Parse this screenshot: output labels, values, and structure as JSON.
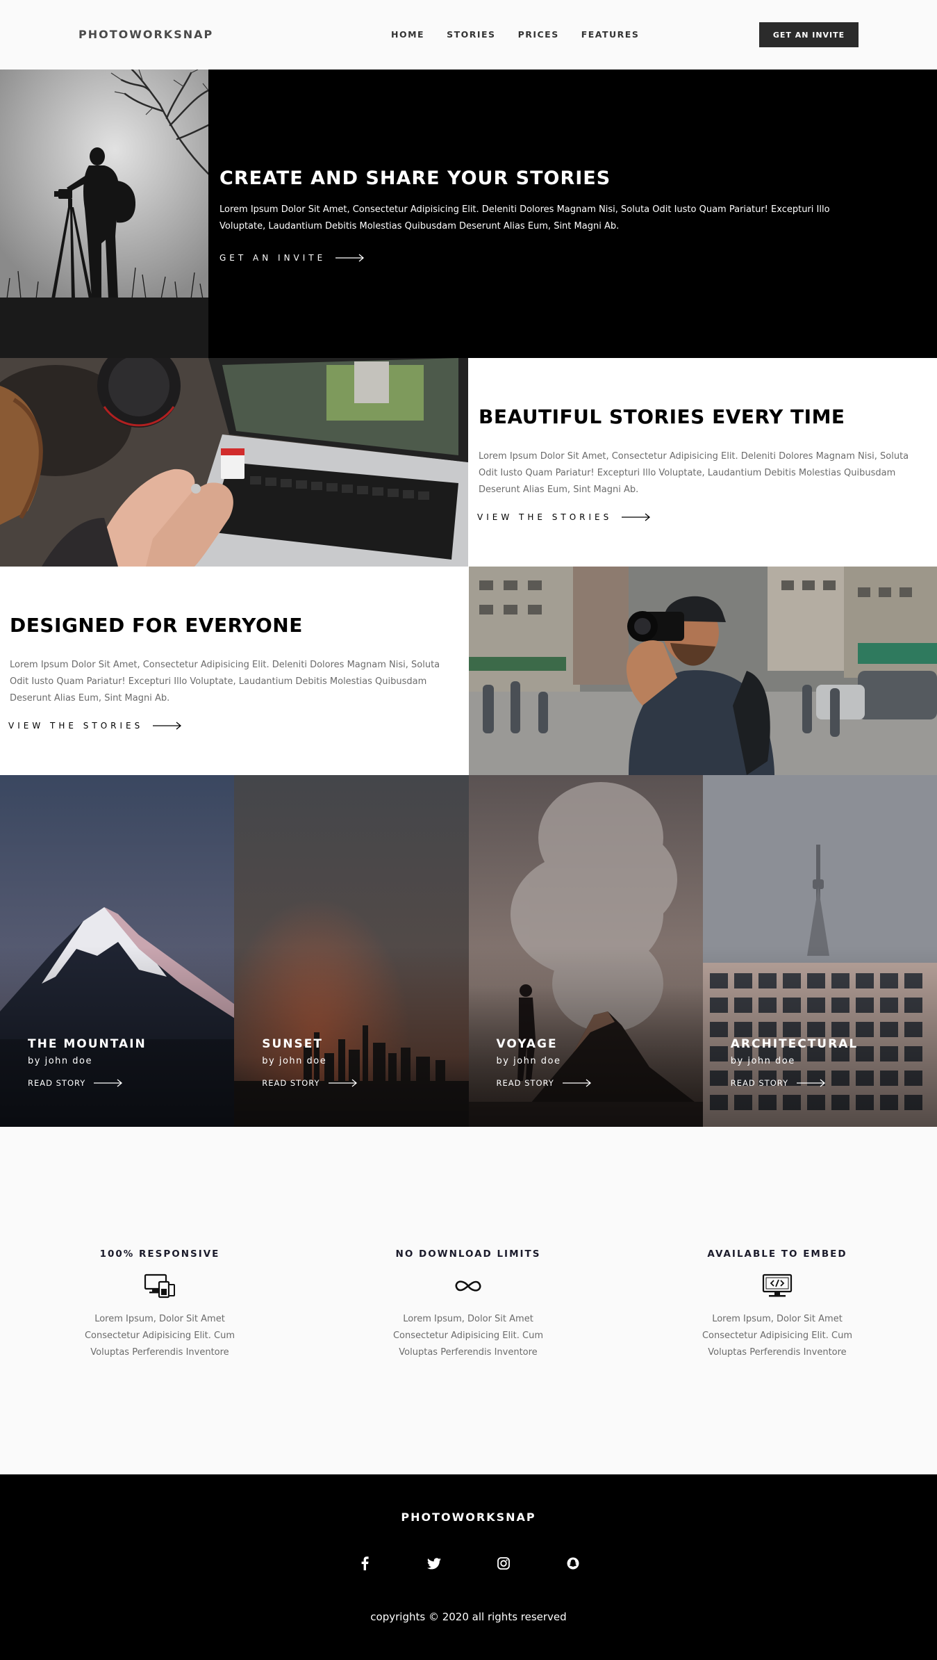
{
  "nav": {
    "brand": "PHOTOWORKSNAP",
    "links": [
      "HOME",
      "STORIES",
      "PRICES",
      "FEATURES"
    ],
    "cta_label": "GET AN INVITE"
  },
  "hero": {
    "title": "CREATE AND SHARE YOUR STORIES",
    "text": "Lorem Ipsum Dolor Sit Amet, Consectetur Adipisicing Elit. Deleniti Dolores Magnam Nisi, Soluta Odit Iusto Quam Pariatur! Excepturi Illo Voluptate, Laudantium Debitis Molestias Quibusdam Deserunt Alias Eum, Sint Magni Ab.",
    "cta_label": "GET AN INVITE"
  },
  "features": [
    {
      "title": "BEAUTIFUL STORIES EVERY TIME",
      "text": "Lorem Ipsum Dolor Sit Amet, Consectetur Adipisicing Elit. Deleniti Dolores Magnam Nisi, Soluta Odit Iusto Quam Pariatur! Excepturi Illo Voluptate, Laudantium Debitis Molestias Quibusdam Deserunt Alias Eum, Sint Magni Ab.",
      "cta_label": "VIEW THE STORIES"
    },
    {
      "title": "DESIGNED FOR EVERYONE",
      "text": "Lorem Ipsum Dolor Sit Amet, Consectetur Adipisicing Elit. Deleniti Dolores Magnam Nisi, Soluta Odit Iusto Quam Pariatur! Excepturi Illo Voluptate, Laudantium Debitis Molestias Quibusdam Deserunt Alias Eum, Sint Magni Ab.",
      "cta_label": "VIEW THE STORIES"
    }
  ],
  "stories": [
    {
      "title": "THE MOUNTAIN",
      "author": "by john doe",
      "cta_label": "READ STORY"
    },
    {
      "title": "SUNSET",
      "author": "by john doe",
      "cta_label": "READ STORY"
    },
    {
      "title": "VOYAGE",
      "author": "by john doe",
      "cta_label": "READ STORY"
    },
    {
      "title": "ARCHITECTURAL",
      "author": "by john doe",
      "cta_label": "READ STORY"
    }
  ],
  "benefits": [
    {
      "title": "100% RESPONSIVE",
      "icon": "responsive-devices-icon",
      "text": "Lorem Ipsum, Dolor Sit Amet Consectetur Adipisicing Elit. Cum Voluptas Perferendis Inventore"
    },
    {
      "title": "NO DOWNLOAD LIMITS",
      "icon": "infinity-icon",
      "text": "Lorem Ipsum, Dolor Sit Amet Consectetur Adipisicing Elit. Cum Voluptas Perferendis Inventore"
    },
    {
      "title": "AVAILABLE TO EMBED",
      "icon": "embed-code-icon",
      "text": "Lorem Ipsum, Dolor Sit Amet Consectetur Adipisicing Elit. Cum Voluptas Perferendis Inventore"
    }
  ],
  "footer": {
    "brand": "PHOTOWORKSNAP",
    "social": [
      "facebook-icon",
      "twitter-icon",
      "instagram-icon",
      "snapchat-icon"
    ],
    "copyright": "copyrights © 2020 all rights reserved"
  },
  "colors": {
    "page_bg": "#fafafa",
    "dark": "#000000",
    "button_bg": "#2b2b2b",
    "body_text": "#6b6b6b"
  }
}
